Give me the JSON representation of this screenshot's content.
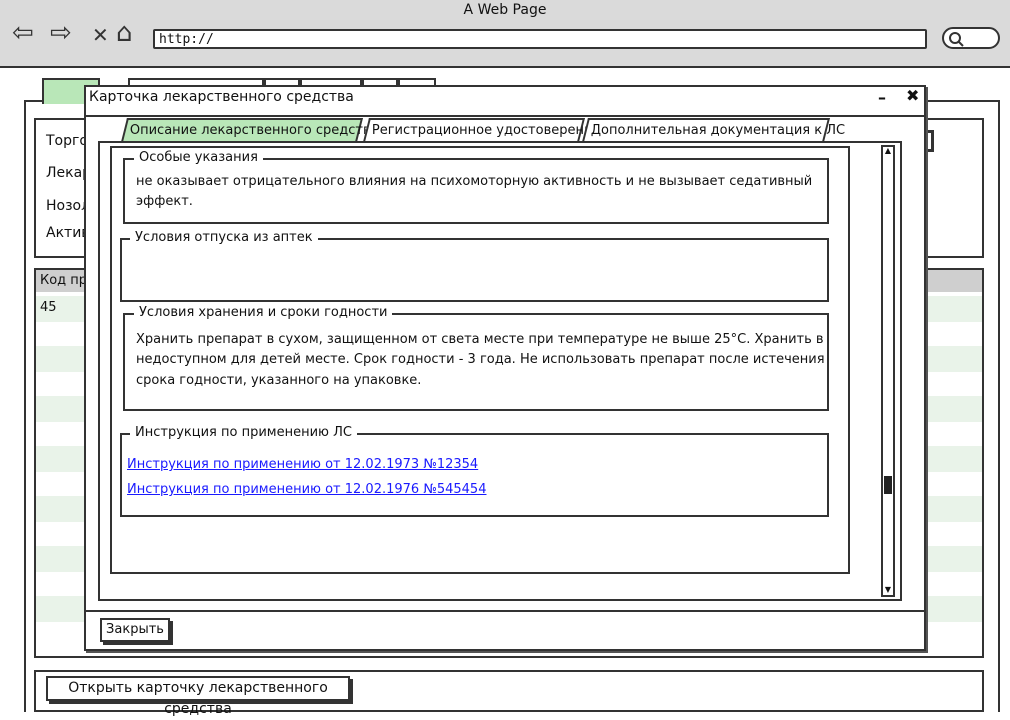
{
  "window": {
    "title": "A Web Page"
  },
  "browser": {
    "url": "http://"
  },
  "background_page": {
    "filter_labels": [
      "Торго",
      "Лекар",
      "Нозол",
      "Актив"
    ],
    "table_header": "Код пр",
    "first_row_value": "45",
    "open_card_button": "Открыть карточку лекарственного средства"
  },
  "modal": {
    "title": "Карточка лекарственного средства",
    "tabs": [
      {
        "label": "Описание лекарственного средства",
        "active": true
      },
      {
        "label": "Регистрационное удостоверение",
        "active": false
      },
      {
        "label": "Дополнительная документация к ЛС",
        "active": false
      }
    ],
    "sections": {
      "special_notes": {
        "legend": "Особые указания",
        "line1": "не оказывает отрицательного влияния на психомоторную активность и не вызывает седативный",
        "line2": "эффект."
      },
      "dispensing": {
        "legend": "Условия отпуска из аптек"
      },
      "storage": {
        "legend": "Условия хранения и сроки годности",
        "line1": "Хранить препарат в сухом, защищенном от света месте при температуре не выше 25°С. Хранить в",
        "line2": "недоступном для детей месте. Срок годности - 3 года. Не использовать препарат после истечения",
        "line3": "срока годности, указанного на упаковке."
      },
      "instructions": {
        "legend": "Инструкция по применению ЛС",
        "links": [
          "Инструкция по применению от 12.02.1973 №12354",
          "Инструкция по применению от 12.02.1976 №545454"
        ]
      }
    },
    "close_button": "Закрыть"
  },
  "colors": {
    "active_tab": "#b9e7b8",
    "link": "#1a1aff",
    "chrome": "#dadada"
  },
  "icons": [
    "back-arrow-icon",
    "forward-arrow-icon",
    "stop-icon",
    "home-icon",
    "search-icon",
    "minimize-icon",
    "close-icon"
  ]
}
